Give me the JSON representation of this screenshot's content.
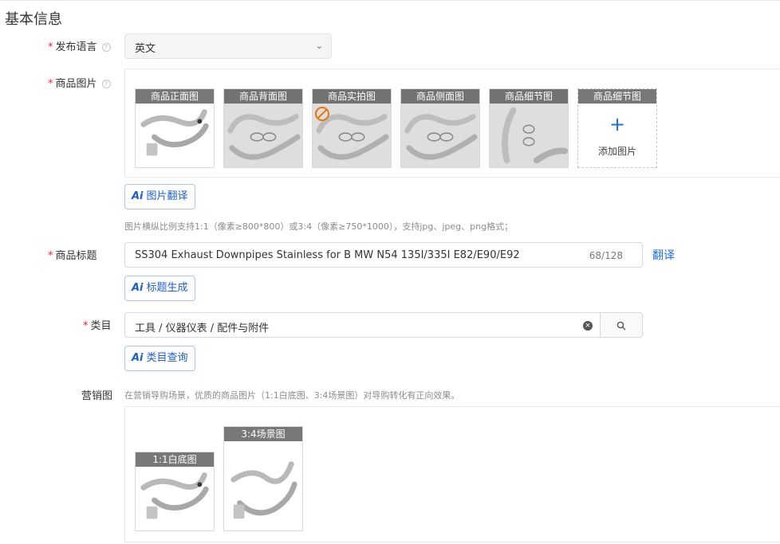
{
  "section": {
    "title": "基本信息"
  },
  "language": {
    "label": "发布语言",
    "value": "英文"
  },
  "images": {
    "label": "商品图片",
    "thumbs": [
      "商品正面图",
      "商品背面图",
      "商品实拍图",
      "商品侧面图",
      "商品细节图"
    ],
    "add_caption": "商品细节图",
    "add_label": "添加图片",
    "translate_btn": "图片翻译",
    "hint": "图片横纵比例支持1:1（像素≥800*800）或3:4（像素≥750*1000），支持jpg、jpeg、png格式；"
  },
  "title": {
    "label": "商品标题",
    "value": "SS304 Exhaust Downpipes Stainless for B MW N54 135I/335I E82/E90/E92",
    "count": "68/128",
    "translate_link": "翻译",
    "generate_btn": "标题生成"
  },
  "category": {
    "label": "类目",
    "value": "工具 / 仪器仪表 / 配件与附件",
    "query_btn": "类目查询"
  },
  "marketing": {
    "label": "营销图",
    "hint": "在营销导购场景，优质的商品图片（1:1白底图、3:4场景图）对导购转化有正向效果。",
    "thumbs": [
      "1:1白底图",
      "3:4场景图"
    ]
  },
  "ai_mark": "Ai",
  "icons": {
    "help": "question-circle-icon",
    "chevron": "chevron-down-icon",
    "clear": "close-circle-icon",
    "search": "search-icon",
    "add": "plus-icon",
    "warning": "prohibited-icon"
  },
  "colors": {
    "required": "#f5222d",
    "link": "#1f6fe0",
    "ai": "#1f5fc6"
  }
}
